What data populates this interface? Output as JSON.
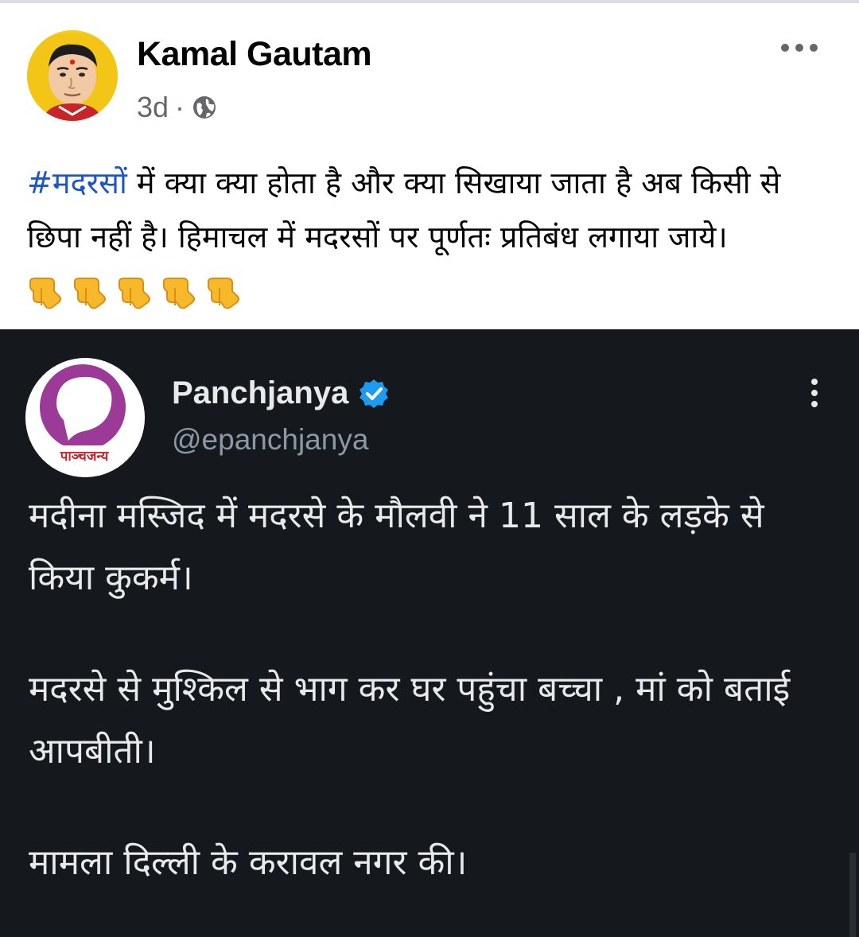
{
  "post": {
    "author": "Kamal Gautam",
    "time": "3d",
    "separator": "·",
    "privacy_icon": "globe-icon",
    "menu_icon": "more-horizontal-icon",
    "hashtag": "#मदरसों",
    "text": " में क्या क्या होता है और क्या सिखाया जाता है अब किसी से छिपा नहीं है। हिमाचल में मदरसों पर पूर्णतः प्रतिबंध लगाया जाये।",
    "emoji": "👇👇👇👇👇"
  },
  "tweet": {
    "name": "Panchjanya",
    "handle": "@epanchjanya",
    "verified_icon": "verified-badge-icon",
    "menu_icon": "more-vertical-icon",
    "logo_text": "पाञ्चजन्य",
    "paragraphs": [
      "मदीना मस्जिद में मदरसे के मौलवी ने 11 साल के लड़के से किया कुकर्म।",
      "मदरसे से मुश्किल से भाग कर घर पहुंचा बच्चा , मां को बताई आपबीती।",
      "मामला दिल्ली के करावल नगर की।"
    ]
  },
  "colors": {
    "hashtag": "#1b56c9",
    "tweet_bg": "#15181c",
    "verified": "#1d9bf0",
    "logo_purple": "#9b3b97"
  }
}
